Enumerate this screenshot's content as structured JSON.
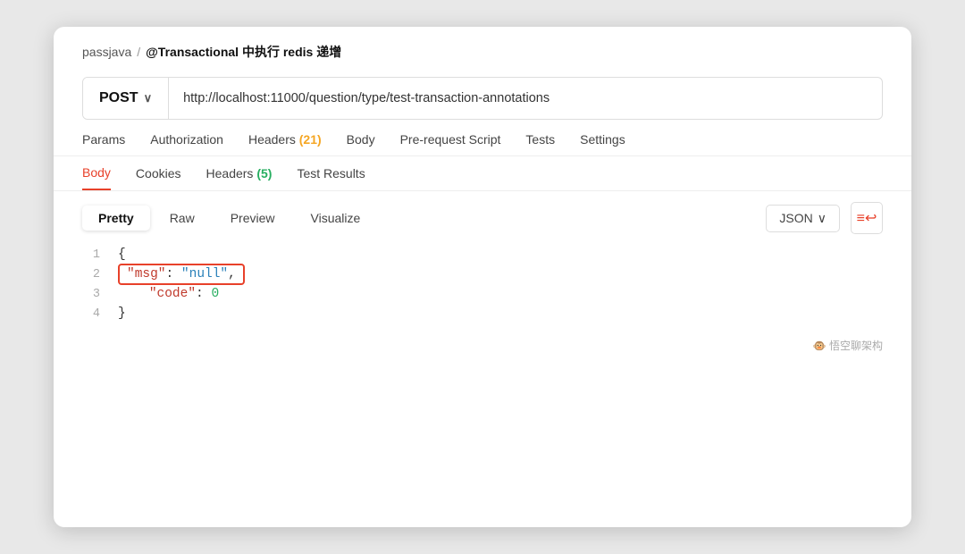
{
  "breadcrumb": {
    "link": "passjava",
    "separator": "/",
    "title": "@Transactional 中执行 redis 递增"
  },
  "url_bar": {
    "method": "POST",
    "chevron": "∨",
    "url": "http://localhost:11000/question/type/test-transaction-annotations"
  },
  "top_tabs": [
    {
      "label": "Params",
      "active": false,
      "badge": null
    },
    {
      "label": "Authorization",
      "active": false,
      "badge": null
    },
    {
      "label": "Headers",
      "active": false,
      "badge": "(21)",
      "badge_type": "orange"
    },
    {
      "label": "Body",
      "active": false,
      "badge": null
    },
    {
      "label": "Pre-request Script",
      "active": false,
      "badge": null
    },
    {
      "label": "Tests",
      "active": false,
      "badge": null
    },
    {
      "label": "Settings",
      "active": false,
      "badge": null
    }
  ],
  "response_tabs": [
    {
      "label": "Body",
      "active": true,
      "badge": null
    },
    {
      "label": "Cookies",
      "active": false,
      "badge": null
    },
    {
      "label": "Headers",
      "active": false,
      "badge": "(5)",
      "badge_type": "green"
    },
    {
      "label": "Test Results",
      "active": false,
      "badge": null
    }
  ],
  "format_buttons": [
    {
      "label": "Pretty",
      "active": true
    },
    {
      "label": "Raw",
      "active": false
    },
    {
      "label": "Preview",
      "active": false
    },
    {
      "label": "Visualize",
      "active": false
    }
  ],
  "json_selector": {
    "label": "JSON",
    "chevron": "∨"
  },
  "wrap_icon": "⇌",
  "code_lines": [
    {
      "num": "1",
      "content": "{",
      "type": "brace"
    },
    {
      "num": "2",
      "content_key": "\"msg\"",
      "content_val": " \"null\",",
      "highlighted": true
    },
    {
      "num": "3",
      "content_key": "\"code\"",
      "content_val": " 0",
      "highlighted": false
    },
    {
      "num": "4",
      "content": "}",
      "type": "brace"
    }
  ],
  "watermark": "悟空聊架构"
}
